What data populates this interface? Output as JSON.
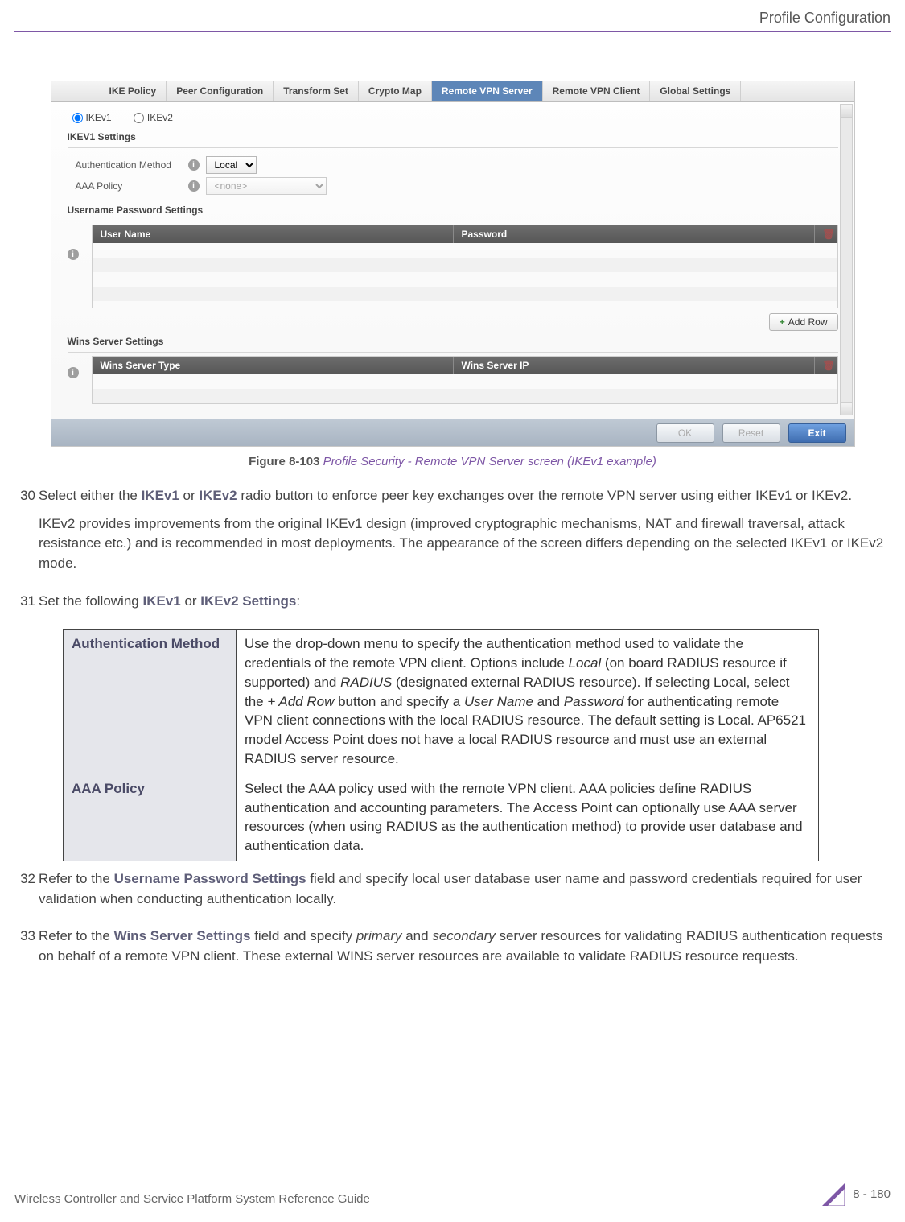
{
  "header": {
    "section": "Profile Configuration"
  },
  "screenshot": {
    "tabs": [
      "IKE Policy",
      "Peer Configuration",
      "Transform Set",
      "Crypto Map",
      "Remote VPN Server",
      "Remote VPN Client",
      "Global Settings"
    ],
    "selected_tab_index": 4,
    "radios": {
      "ikev1": "IKEv1",
      "ikev2": "IKEv2"
    },
    "section1_title": "IKEV1 Settings",
    "auth_label": "Authentication Method",
    "auth_value": "Local",
    "aaa_label": "AAA Policy",
    "aaa_placeholder": "<none>",
    "section2_title": "Username Password Settings",
    "grid1_cols": {
      "c1": "User Name",
      "c2": "Password"
    },
    "addrow": "Add Row",
    "section3_title": "Wins Server Settings",
    "grid2_cols": {
      "c1": "Wins Server Type",
      "c2": "Wins Server IP"
    },
    "buttons": {
      "ok": "OK",
      "reset": "Reset",
      "exit": "Exit"
    }
  },
  "figure": {
    "num": "Figure 8-103",
    "caption": "Profile Security - Remote VPN Server screen (IKEv1 example)"
  },
  "steps": {
    "s30": {
      "num": "30",
      "p1a": "Select either the ",
      "p1b": "IKEv1",
      "p1c": " or ",
      "p1d": "IKEv2",
      "p1e": " radio button to enforce peer key exchanges over the remote VPN server using either IKEv1 or IKEv2.",
      "p2": "IKEv2 provides improvements from the original IKEv1 design (improved cryptographic mechanisms, NAT and firewall traversal, attack resistance etc.) and is recommended in most deployments. The appearance of the screen differs depending on the selected IKEv1 or IKEv2 mode."
    },
    "s31": {
      "num": "31",
      "p1a": "Set the following ",
      "p1b": "IKEv1",
      "p1c": " or ",
      "p1d": "IKEv2 Settings",
      "p1e": ":"
    },
    "s32": {
      "num": "32",
      "p1a": "Refer to the ",
      "p1b": "Username Password Settings",
      "p1c": " field and specify local user database user name and password credentials required for user validation when conducting authentication locally."
    },
    "s33": {
      "num": "33",
      "p1a": "Refer to the ",
      "p1b": "Wins Server Settings",
      "p1c": " field and specify ",
      "p1d": "primary",
      "p1e": " and ",
      "p1f": "secondary",
      "p1g": " server resources for validating RADIUS authentication requests on behalf of a remote VPN client. These external WINS server resources are available to validate RADIUS resource requests."
    }
  },
  "table": {
    "row1_key": "Authentication Method",
    "row1_val_a": "Use the drop-down menu to specify the authentication method used to validate the credentials of the remote VPN client. Options include ",
    "row1_val_b": "Local",
    "row1_val_c": " (on board RADIUS resource if supported) and ",
    "row1_val_d": "RADIUS",
    "row1_val_e": " (designated external RADIUS resource). If selecting Local, select the ",
    "row1_val_f": "+ Add Row",
    "row1_val_g": " button and specify a ",
    "row1_val_h": "User Name",
    "row1_val_i": " and ",
    "row1_val_j": "Password",
    "row1_val_k": " for authenticating remote VPN client connections with the local RADIUS resource. The default setting is Local. AP6521 model Access Point does not have a local RADIUS resource and must use an external RADIUS server resource.",
    "row2_key": "AAA Policy",
    "row2_val": "Select the AAA policy used with the remote VPN client. AAA policies define RADIUS authentication and accounting parameters. The Access Point can optionally use AAA server resources (when using RADIUS as the authentication method) to provide user database and authentication data."
  },
  "footer": {
    "left": "Wireless Controller and Service Platform System Reference Guide",
    "right": "8 - 180"
  }
}
